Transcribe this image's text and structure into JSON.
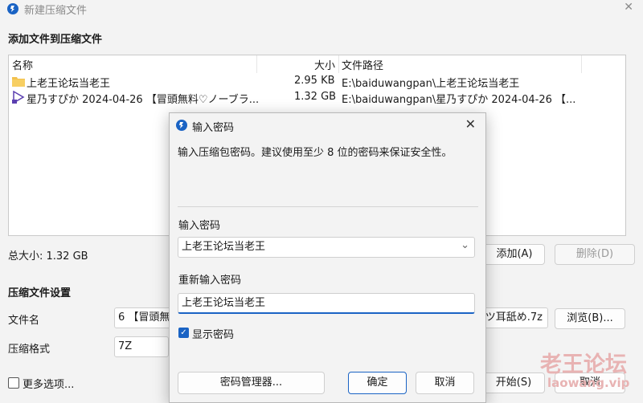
{
  "window": {
    "title": "新建压缩文件",
    "close_glyph": "✕"
  },
  "section_add": "添加文件到压缩文件",
  "file_list": {
    "headers": {
      "name": "名称",
      "size": "大小",
      "path": "文件路径"
    },
    "rows": [
      {
        "icon": "folder-icon",
        "name": "上老王论坛当老王",
        "size": "2.95 KB",
        "path": "E:\\baiduwangpan\\上老王论坛当老王"
      },
      {
        "icon": "video-file-icon",
        "name": "星乃すぴか 2024-04-26 【冒頭無料♡ノーブラ...",
        "size": "1.32 GB",
        "path": "E:\\baiduwangpan\\星乃すぴか 2024-04-26 【..."
      }
    ]
  },
  "total_size": "总大小: 1.32 GB",
  "buttons": {
    "add": "添加(A)",
    "delete": "删除(D)",
    "browse": "浏览(B)...",
    "start": "开始(S)",
    "cancel": "取消"
  },
  "section_settings": "压缩文件设置",
  "filename": {
    "label": "文件名",
    "value_left": "6 【冒頭無",
    "value_right": "ッツ耳舐め.7z"
  },
  "format": {
    "label": "压缩格式",
    "value": "7Z"
  },
  "more_options": "更多选项...",
  "dialog": {
    "title": "输入密码",
    "close_glyph": "✕",
    "description": "输入压缩包密码。建议使用至少 8 位的密码来保证安全性。",
    "password_label": "输入密码",
    "password_value": "上老王论坛当老王",
    "dropdown_glyph": "⌄",
    "repeat_label": "重新输入密码",
    "repeat_value": "上老王论坛当老王",
    "show_password_label": "显示密码",
    "show_password_checked": true,
    "check_glyph": "✓",
    "manager_button": "密码管理器...",
    "ok_button": "确定",
    "cancel_button": "取消"
  },
  "watermark": {
    "line1": "老王论坛",
    "line2": "laowang.vip"
  },
  "colors": {
    "accent": "#1a63c4",
    "folder": "#f2c14e",
    "watermark": "#e8b3b3"
  }
}
